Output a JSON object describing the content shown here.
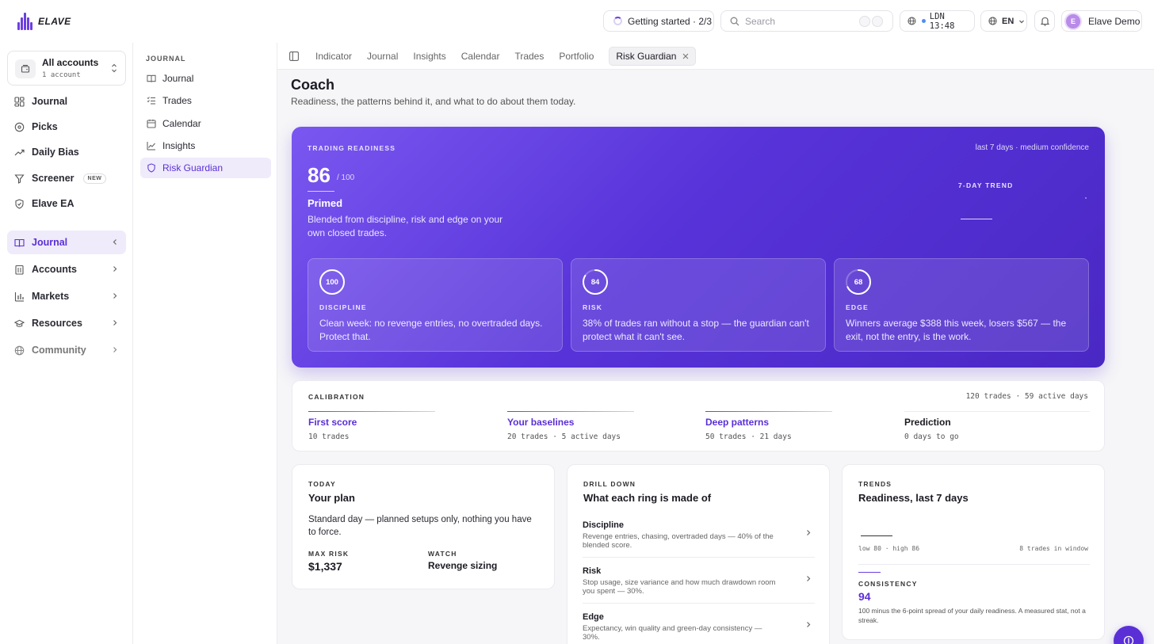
{
  "brand": {
    "name": "ELAVE"
  },
  "topbar": {
    "getting_started": "Getting started · 2/3",
    "search_placeholder": "Search",
    "clock": "LDN 13:48",
    "language": "EN",
    "user_initial": "E",
    "user_name": "Elave Demo"
  },
  "account_switcher": {
    "title": "All accounts",
    "subtitle": "1 account"
  },
  "sidebar": {
    "items": [
      {
        "label": "Journal",
        "icon": "grid-icon"
      },
      {
        "label": "Picks",
        "icon": "target-icon"
      },
      {
        "label": "Daily Bias",
        "icon": "trend-up-icon"
      },
      {
        "label": "Screener",
        "icon": "filter-icon",
        "badge": "NEW"
      },
      {
        "label": "Elave EA",
        "icon": "shield-check-icon"
      }
    ],
    "groups": [
      {
        "label": "Journal",
        "icon": "book-icon",
        "active": true
      },
      {
        "label": "Accounts",
        "icon": "building-icon"
      },
      {
        "label": "Markets",
        "icon": "bar-chart-icon"
      },
      {
        "label": "Resources",
        "icon": "graduation-icon"
      },
      {
        "label": "Community",
        "icon": "globe-icon"
      }
    ]
  },
  "subnav": {
    "heading": "JOURNAL",
    "items": [
      {
        "label": "Journal",
        "icon": "book-icon"
      },
      {
        "label": "Trades",
        "icon": "list-icon"
      },
      {
        "label": "Calendar",
        "icon": "calendar-icon"
      },
      {
        "label": "Insights",
        "icon": "line-chart-icon"
      },
      {
        "label": "Risk Guardian",
        "icon": "shield-icon",
        "active": true
      }
    ]
  },
  "tabs": [
    "Indicator",
    "Journal",
    "Insights",
    "Calendar",
    "Trades",
    "Portfolio",
    "Risk Guardian"
  ],
  "page": {
    "title": "Coach",
    "subtitle": "Readiness, the patterns behind it, and what to do about them today."
  },
  "readiness": {
    "label": "TRADING READINESS",
    "confidence": "last 7 days · medium confidence",
    "score": "86",
    "max": "/ 100",
    "state": "Primed",
    "description": "Blended from discipline, risk and edge on your own closed trades.",
    "trend_label": "7-DAY TREND",
    "rings": [
      {
        "value": 100,
        "value_text": "100",
        "name": "DISCIPLINE",
        "desc": "Clean week: no revenge entries, no overtraded days. Protect that."
      },
      {
        "value": 84,
        "value_text": "84",
        "name": "RISK",
        "desc": "38% of trades ran without a stop — the guardian can't protect what it can't see."
      },
      {
        "value": 68,
        "value_text": "68",
        "name": "EDGE",
        "desc": "Winners average $388 this week, losers $567 — the exit, not the entry, is the work."
      }
    ]
  },
  "calibration": {
    "label": "CALIBRATION",
    "summary": "120 trades · 59 active days",
    "steps": [
      {
        "name": "First score",
        "sub": "10 trades"
      },
      {
        "name": "Your baselines",
        "sub": "20 trades · 5 active days"
      },
      {
        "name": "Deep patterns",
        "sub": "50 trades · 21 days"
      },
      {
        "name": "Prediction",
        "sub": "0 days to go"
      }
    ]
  },
  "plan": {
    "label": "TODAY",
    "title": "Your plan",
    "text": "Standard day — planned setups only, nothing you have to force.",
    "max_risk_label": "MAX RISK",
    "max_risk": "$1,337",
    "watch_label": "WATCH",
    "watch": "Revenge sizing"
  },
  "drill": {
    "label": "DRILL DOWN",
    "title": "What each ring is made of",
    "rows": [
      {
        "name": "Discipline",
        "desc": "Revenge entries, chasing, overtraded days — 40% of the blended score."
      },
      {
        "name": "Risk",
        "desc": "Stop usage, size variance and how much drawdown room you spent — 30%."
      },
      {
        "name": "Edge",
        "desc": "Expectancy, win quality and green-day consistency — 30%."
      }
    ]
  },
  "trends": {
    "label": "TRENDS",
    "title": "Readiness, last 7 days",
    "range": "low 80 · high 86",
    "window": "8 trades in window",
    "consistency_label": "CONSISTENCY",
    "consistency": "94",
    "consistency_desc": "100 minus the 6-point spread of your daily readiness. A measured stat, not a streak."
  },
  "colors": {
    "accent": "#5a2fd6",
    "hero_start": "#7a57f0",
    "hero_end": "#4a28c4"
  }
}
